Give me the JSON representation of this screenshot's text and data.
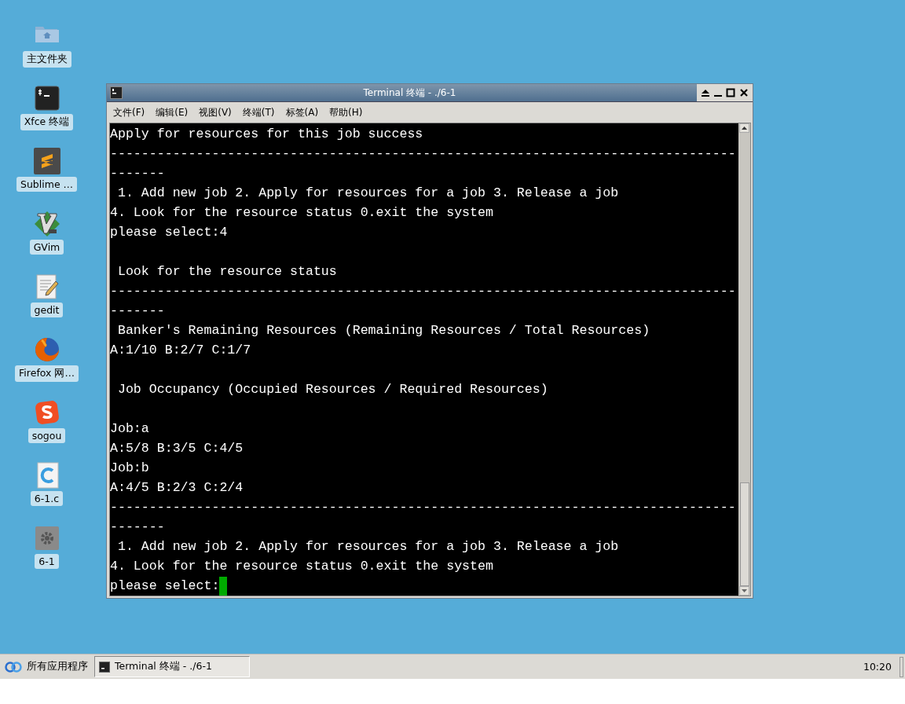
{
  "desktop_icons": [
    {
      "label": "主文件夹",
      "kind": "folder"
    },
    {
      "label": "Xfce 终端",
      "kind": "terminal"
    },
    {
      "label": "Sublime …",
      "kind": "sublime"
    },
    {
      "label": "GVim",
      "kind": "vim"
    },
    {
      "label": "gedit",
      "kind": "editor"
    },
    {
      "label": "Firefox 网…",
      "kind": "firefox"
    },
    {
      "label": "sogou",
      "kind": "sogou"
    },
    {
      "label": "6-1.c",
      "kind": "csource"
    },
    {
      "label": "6-1",
      "kind": "executable"
    }
  ],
  "window": {
    "title": "Terminal 终端 - ./6-1",
    "menu": [
      "文件(F)",
      "编辑(E)",
      "视图(V)",
      "终端(T)",
      "标签(A)",
      "帮助(H)"
    ],
    "lines": [
      {
        "kind": "text",
        "text": "Apply for resources for this job success"
      },
      {
        "kind": "text",
        "text": "--------------------------------------------------------------------------------"
      },
      {
        "kind": "text",
        "text": "-------"
      },
      {
        "kind": "text",
        "text": " 1. Add new job 2. Apply for resources for a job 3. Release a job"
      },
      {
        "kind": "text",
        "text": "4. Look for the resource status 0.exit the system"
      },
      {
        "kind": "text",
        "text": "please select:4"
      },
      {
        "kind": "blank"
      },
      {
        "kind": "text",
        "text": " Look for the resource status"
      },
      {
        "kind": "text",
        "text": "--------------------------------------------------------------------------------"
      },
      {
        "kind": "text",
        "text": "-------"
      },
      {
        "kind": "text",
        "text": " Banker's Remaining Resources (Remaining Resources / Total Resources)"
      },
      {
        "kind": "text",
        "text": "A:1/10 B:2/7 C:1/7"
      },
      {
        "kind": "blank"
      },
      {
        "kind": "text",
        "text": " Job Occupancy (Occupied Resources / Required Resources)"
      },
      {
        "kind": "blank"
      },
      {
        "kind": "text",
        "text": "Job:a"
      },
      {
        "kind": "text",
        "text": "A:5/8 B:3/5 C:4/5"
      },
      {
        "kind": "text",
        "text": "Job:b"
      },
      {
        "kind": "text",
        "text": "A:4/5 B:2/3 C:2/4"
      },
      {
        "kind": "text",
        "text": "--------------------------------------------------------------------------------"
      },
      {
        "kind": "text",
        "text": "-------"
      },
      {
        "kind": "text",
        "text": " 1. Add new job 2. Apply for resources for a job 3. Release a job"
      },
      {
        "kind": "text",
        "text": "4. Look for the resource status 0.exit the system"
      },
      {
        "kind": "prompt",
        "text": "please select:"
      }
    ]
  },
  "taskbar": {
    "menu_label": "所有应用程序",
    "tasks": [
      {
        "label": "Terminal 终端 - ./6-1",
        "selected": true
      }
    ],
    "clock": "10:20"
  }
}
